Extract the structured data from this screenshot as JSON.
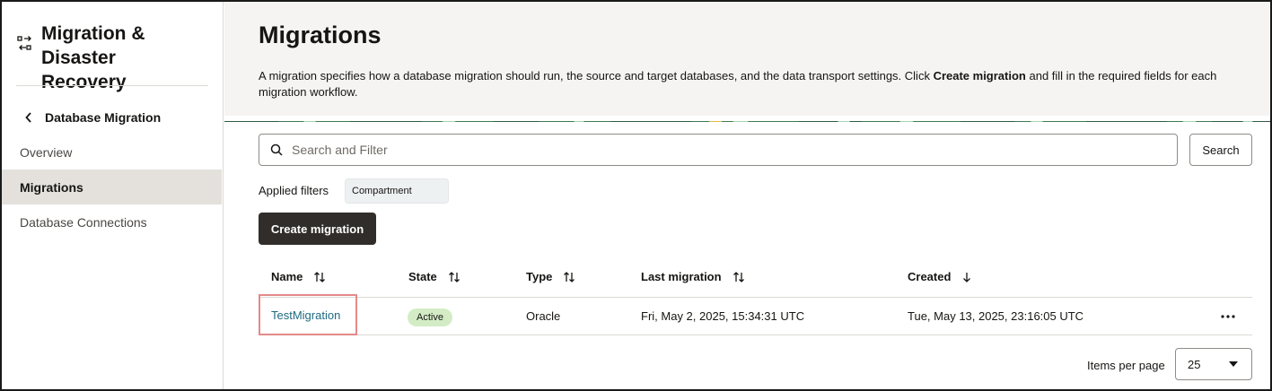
{
  "sidebar": {
    "service_title": "Migration & Disaster Recovery",
    "back_label": "Database Migration",
    "items": [
      {
        "label": "Overview",
        "active": false
      },
      {
        "label": "Migrations",
        "active": true
      },
      {
        "label": "Database Connections",
        "active": false
      }
    ]
  },
  "header": {
    "title": "Migrations",
    "description_pre": "A migration specifies how a database migration should run, the source and target databases, and the data transport settings. Click ",
    "description_bold": "Create migration",
    "description_post": " and fill in the required fields for each migration workflow."
  },
  "search": {
    "placeholder": "Search and Filter",
    "button_label": "Search"
  },
  "filters": {
    "label": "Applied filters",
    "chips": [
      "Compartment"
    ]
  },
  "actions": {
    "create_label": "Create migration"
  },
  "table": {
    "columns": [
      {
        "label": "Name",
        "sort": "both"
      },
      {
        "label": "State",
        "sort": "both"
      },
      {
        "label": "Type",
        "sort": "both"
      },
      {
        "label": "Last migration",
        "sort": "both"
      },
      {
        "label": "Created",
        "sort": "descending"
      }
    ],
    "rows": [
      {
        "name": "TestMigration",
        "state": "Active",
        "type": "Oracle",
        "last_migration": "Fri, May 2, 2025, 15:34:31 UTC",
        "created": "Tue, May 13, 2025, 23:16:05 UTC"
      }
    ]
  },
  "pagination": {
    "label": "Items per page",
    "value": "25"
  },
  "colors": {
    "primary_button": "#312d2a",
    "link": "#1f6a80",
    "active_badge": "#d4ecc5",
    "nav_active": "#e4e1dd",
    "header_band": "#f5f4f2",
    "highlight_border": "#e48a8a"
  },
  "icons": {
    "brand": "migration-arrows-icon",
    "back": "chevron-left-icon",
    "search": "search-icon",
    "sort": "sort-arrows-icon",
    "sort_desc": "arrow-down-icon",
    "more": "more-actions-icon",
    "dropdown": "caret-down-icon"
  }
}
